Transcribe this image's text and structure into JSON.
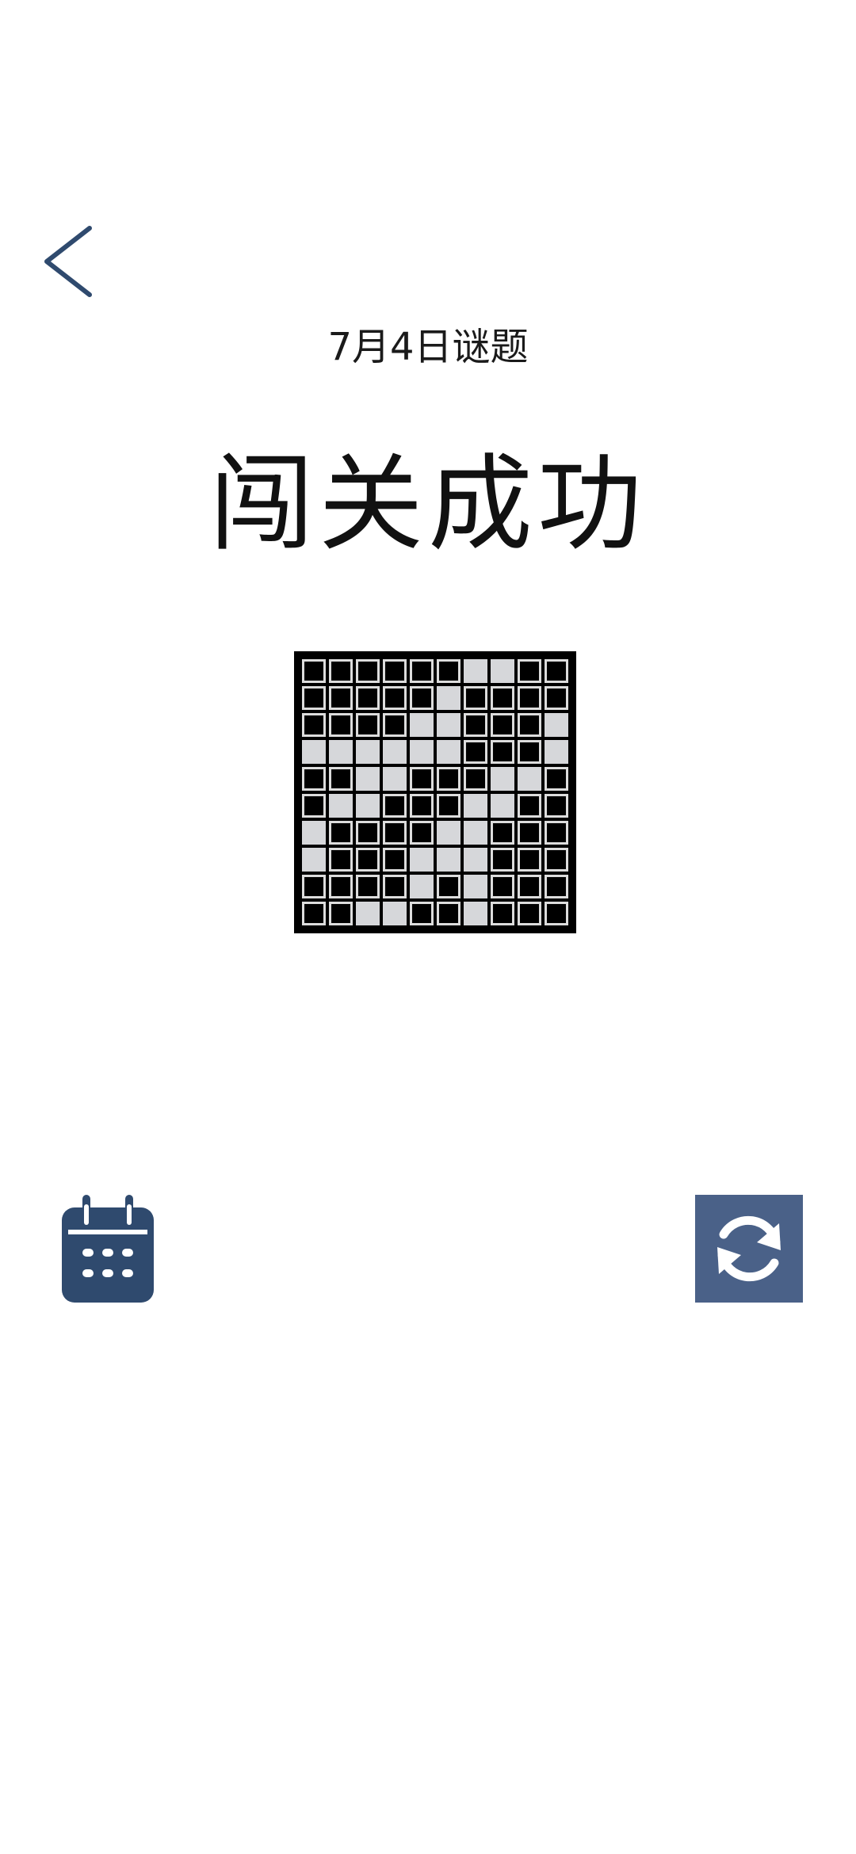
{
  "header": {
    "back_icon": "chevron-left-icon",
    "subtitle": "7月4日谜题",
    "title": "闯关成功"
  },
  "puzzle": {
    "rows": 10,
    "cols": 10,
    "grid": [
      "######..##",
      "#####.####",
      "####..###.",
      "......###.",
      "##..###..#",
      "#..###..##",
      ".####..###",
      ".###...###",
      "####.#.###",
      "##..##.###"
    ]
  },
  "actions": {
    "calendar_icon": "calendar-icon",
    "refresh_icon": "refresh-icon"
  },
  "colors": {
    "accent": "#2f4a6e",
    "refresh_bg": "#4a6188",
    "filled_cell": "#000000",
    "empty_cell": "#d6d7da",
    "board_border": "#000000"
  }
}
